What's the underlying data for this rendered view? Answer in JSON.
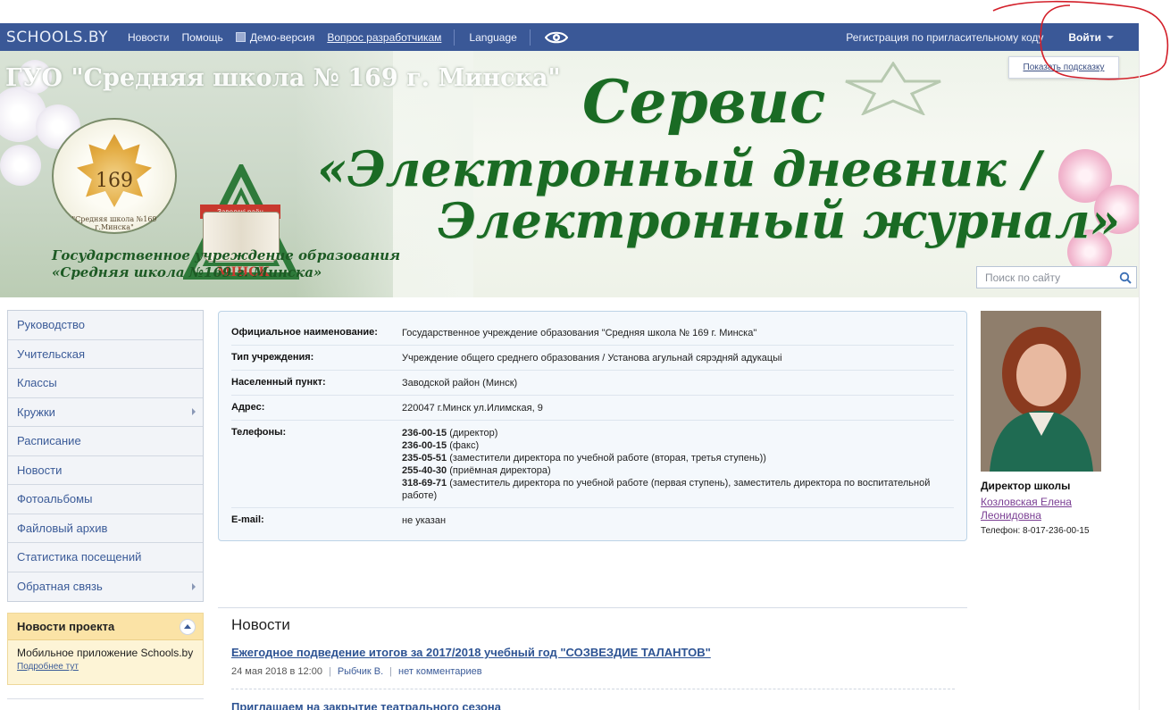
{
  "topbar": {
    "logo": "SCHOOLS.BY",
    "nav": [
      "Новости",
      "Помощь"
    ],
    "demo": "Демо-версия",
    "question": "Вопрос разработчикам",
    "language": "Language",
    "registration": "Регистрация по пригласительному коду",
    "login": "Войти"
  },
  "hint": "Показать подсказку",
  "banner": {
    "school_name": "ГУО \"Средняя школа № 169 г. Минска\"",
    "emblem_number": "169",
    "emblem_caption": "\"Средняя школа №169 г.Минска\"",
    "ribbon": "Заводскі раён",
    "minsk": "МІНСК",
    "gu_line1": "Государственное учреждение образования",
    "gu_line2": "«Средняя школа №169 г. Минска»",
    "service_line1": "Сервис",
    "service_line2": "«Электронный дневник  /",
    "service_line3": "Электронный журнал»"
  },
  "search": {
    "placeholder": "Поиск по сайту"
  },
  "sidebar": {
    "items": [
      {
        "label": "Руководство",
        "arrow": false
      },
      {
        "label": "Учительская",
        "arrow": false
      },
      {
        "label": "Классы",
        "arrow": false
      },
      {
        "label": "Кружки",
        "arrow": true
      },
      {
        "label": "Расписание",
        "arrow": false
      },
      {
        "label": "Новости",
        "arrow": false
      },
      {
        "label": "Фотоальбомы",
        "arrow": false
      },
      {
        "label": "Файловый архив",
        "arrow": false
      },
      {
        "label": "Статистика посещений",
        "arrow": false
      },
      {
        "label": "Обратная связь",
        "arrow": true
      }
    ]
  },
  "project_news": {
    "title": "Новости проекта",
    "text": "Мобильное приложение Schools.by",
    "link": "Подробнее тут"
  },
  "info": {
    "official_label": "Официальное наименование:",
    "official": "Государственное учреждение образования \"Средняя школа № 169 г. Минска\"",
    "type_label": "Тип учреждения:",
    "type": "Учреждение общего среднего образования / Установа агульнай сярэдняй адукацыі",
    "locality_label": "Населенный пункт:",
    "locality": "Заводской район (Минск)",
    "address_label": "Адрес:",
    "address": "220047 г.Минск ул.Илимская, 9",
    "phones_label": "Телефоны:",
    "phones": [
      {
        "num": "236-00-15",
        "note": "(директор)"
      },
      {
        "num": "236-00-15",
        "note": "(факс)"
      },
      {
        "num": "235-05-51",
        "note": "(заместители директора по учебной работе (вторая, третья ступень))"
      },
      {
        "num": "255-40-30",
        "note": "(приёмная директора)"
      },
      {
        "num": "318-69-71",
        "note": "(заместитель директора по учебной работе (первая ступень), заместитель директора по воспитательной работе)"
      }
    ],
    "email_label": "E-mail:",
    "email": "не указан"
  },
  "director": {
    "title": "Директор школы",
    "name": "Козловская Елена Леонидовна",
    "phone": "Телефон: 8-017-236-00-15"
  },
  "news": {
    "heading": "Новости",
    "items": [
      {
        "title": "Ежегодное подведение итогов за 2017/2018 учебный год \"СОЗВЕЗДИЕ ТАЛАНТОВ\"",
        "date": "24 мая 2018 в 12:00",
        "author": "Рыбчик В.",
        "comments": "нет комментариев"
      },
      {
        "title": "Приглашаем на закрытие театрального сезона"
      }
    ]
  }
}
